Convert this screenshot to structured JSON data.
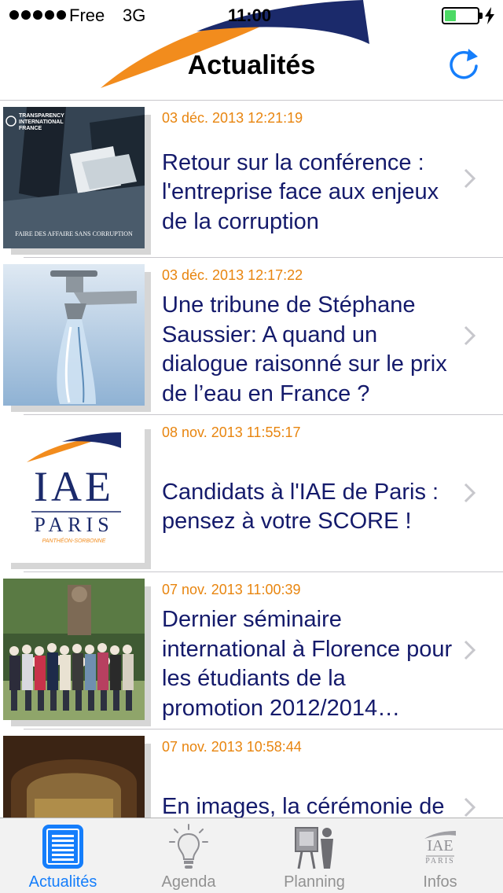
{
  "status_bar": {
    "carrier": "Free",
    "network": "3G",
    "time": "11:00",
    "battery_level": 0.35
  },
  "nav": {
    "title": "Actualités",
    "refresh_icon": "refresh-icon"
  },
  "news": [
    {
      "date": "03 déc. 2013 12:21:19",
      "title": "Retour sur la conférence : l'entreprise face aux enjeux de la corruption",
      "thumb_caption": "FAIRE DES AFFAIRE SANS CORRUPTION",
      "thumb_brand": "TRANSPARENCY INTERNATIONAL FRANCE"
    },
    {
      "date": "03 déc. 2013 12:17:22",
      "title": "Une tribune de Stéphane Saussier: A quand un dialogue raisonné sur le prix de l’eau en France ?"
    },
    {
      "date": "08 nov. 2013 11:55:17",
      "title": "Candidats à l'IAE de Paris : pensez à votre SCORE !",
      "thumb_logo_top": "IAE",
      "thumb_logo_bottom": "PARIS",
      "thumb_logo_sub": "PANTHÉON-SORBONNE"
    },
    {
      "date": "07 nov. 2013 11:00:39",
      "title": "Dernier séminaire international à Florence pour les étudiants de la promotion 2012/2014…"
    },
    {
      "date": "07 nov. 2013 10:58:44",
      "title": "En images, la cérémonie de remise des diplômes"
    }
  ],
  "tabs": [
    {
      "label": "Actualités",
      "icon": "news-list-icon",
      "active": true
    },
    {
      "label": "Agenda",
      "icon": "lightbulb-icon",
      "active": false
    },
    {
      "label": "Planning",
      "icon": "presentation-board-icon",
      "active": false
    },
    {
      "label": "Infos",
      "icon": "iae-paris-logo-icon",
      "active": false,
      "logo_top": "IAE",
      "logo_bottom": "PARIS"
    }
  ],
  "colors": {
    "date": "#e8850f",
    "title": "#141a6b",
    "accent": "#157efb",
    "logo_orange": "#f28c1d",
    "logo_navy": "#1b2a6b"
  }
}
